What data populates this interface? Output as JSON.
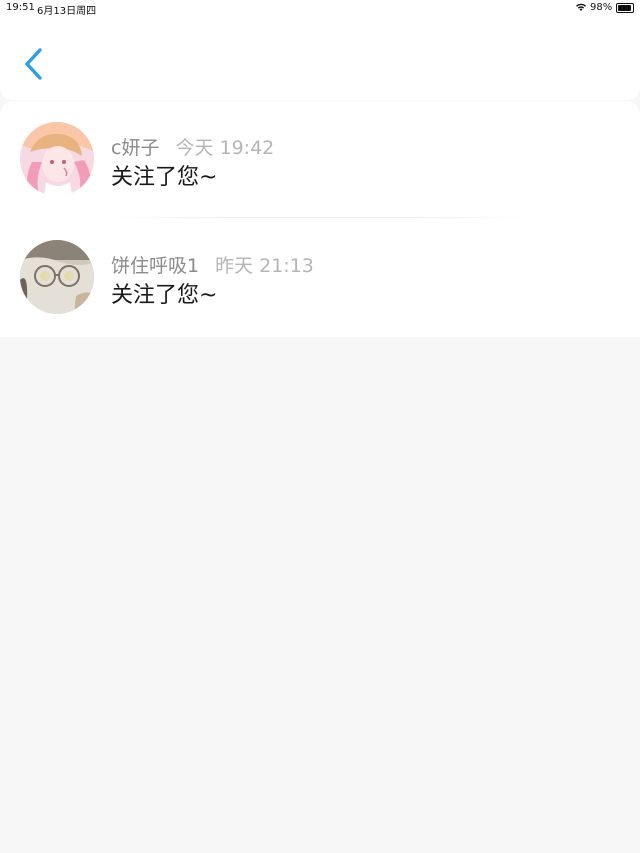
{
  "status_bar": {
    "time": "19:51",
    "date": "6月13日周四",
    "battery_percent": "98%",
    "battery_level": 0.98,
    "wifi_icon": "wifi-icon"
  },
  "header": {
    "back_icon": "chevron-left-icon",
    "accent_color": "#2a9ee8"
  },
  "notifications": [
    {
      "user": "c妍子",
      "time": "今天 19:42",
      "message": "关注了您~"
    },
    {
      "user": "饼住呼吸1",
      "time": "昨天 21:13",
      "message": "关注了您~"
    }
  ]
}
